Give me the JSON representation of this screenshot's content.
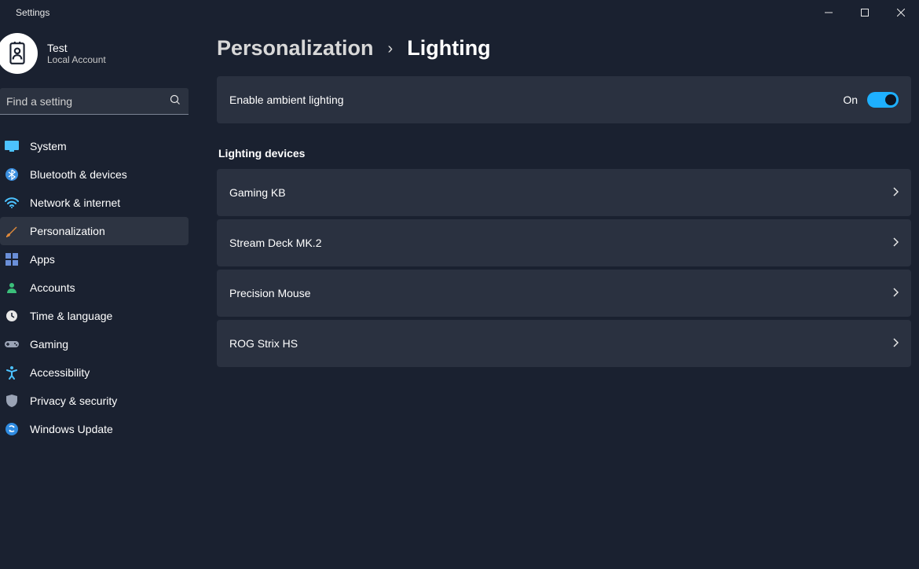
{
  "app": {
    "title": "Settings"
  },
  "profile": {
    "name": "Test",
    "subtitle": "Local Account"
  },
  "search": {
    "placeholder": "Find a setting"
  },
  "nav": {
    "items": [
      {
        "label": "System"
      },
      {
        "label": "Bluetooth & devices"
      },
      {
        "label": "Network & internet"
      },
      {
        "label": "Personalization"
      },
      {
        "label": "Apps"
      },
      {
        "label": "Accounts"
      },
      {
        "label": "Time & language"
      },
      {
        "label": "Gaming"
      },
      {
        "label": "Accessibility"
      },
      {
        "label": "Privacy & security"
      },
      {
        "label": "Windows Update"
      }
    ],
    "selected_index": 3
  },
  "breadcrumb": {
    "parent": "Personalization",
    "current": "Lighting"
  },
  "ambient": {
    "label": "Enable ambient lighting",
    "state_text": "On",
    "on": true
  },
  "devices": {
    "heading": "Lighting devices",
    "items": [
      {
        "label": "Gaming KB"
      },
      {
        "label": "Stream Deck MK.2"
      },
      {
        "label": "Precision Mouse"
      },
      {
        "label": "ROG Strix HS"
      }
    ]
  },
  "colors": {
    "accent": "#1eb0ff"
  }
}
